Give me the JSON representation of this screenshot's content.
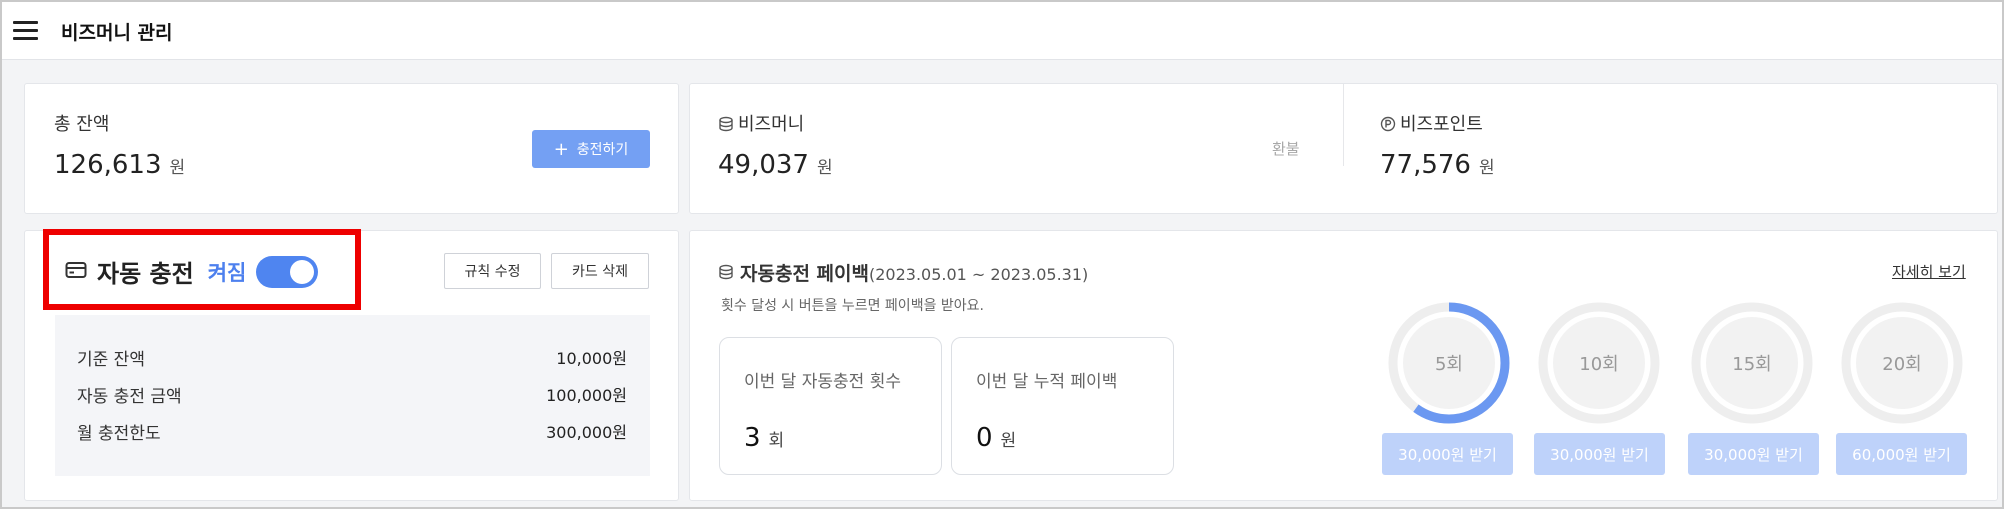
{
  "header": {
    "title": "비즈머니 관리"
  },
  "total": {
    "label": "총 잔액",
    "amount": "126,613",
    "unit": "원",
    "charge_button": "충전하기"
  },
  "bizmoney": {
    "label": "비즈머니",
    "amount": "49,037",
    "unit": "원",
    "refund": "환불"
  },
  "bizpoint": {
    "label": "비즈포인트",
    "amount": "77,576",
    "unit": "원"
  },
  "auto_charge": {
    "title": "자동 충전",
    "state": "켜짐",
    "toggle_on": true,
    "edit_rule": "규칙 수정",
    "delete_card": "카드 삭제",
    "rules": [
      {
        "label": "기준 잔액",
        "value": "10,000원"
      },
      {
        "label": "자동 충전 금액",
        "value": "100,000원"
      },
      {
        "label": "월 충전한도",
        "value": "300,000원"
      }
    ]
  },
  "payback": {
    "title": "자동충전 페이백",
    "period": "(2023.05.01 ~ 2023.05.31)",
    "description": "횟수 달성 시 버튼을 누르면 페이백을 받아요.",
    "detail_link": "자세히 보기",
    "count_label": "이번 달 자동충전 횟수",
    "count_value": "3",
    "count_unit": "회",
    "accum_label": "이번 달 누적 페이백",
    "accum_value": "0",
    "accum_unit": "원",
    "milestones": [
      {
        "label": "5회",
        "progress": 0.6,
        "button": "30,000원 받기"
      },
      {
        "label": "10회",
        "progress": 0,
        "button": "30,000원 받기"
      },
      {
        "label": "15회",
        "progress": 0,
        "button": "30,000원 받기"
      },
      {
        "label": "20회",
        "progress": 0,
        "button": "60,000원 받기"
      }
    ]
  },
  "colors": {
    "accent": "#4f85f0",
    "highlight": "#ee0000",
    "ring_track": "#eeeeee",
    "ring_fill": "#6b98f1",
    "button_disabled": "#bed2fa"
  }
}
